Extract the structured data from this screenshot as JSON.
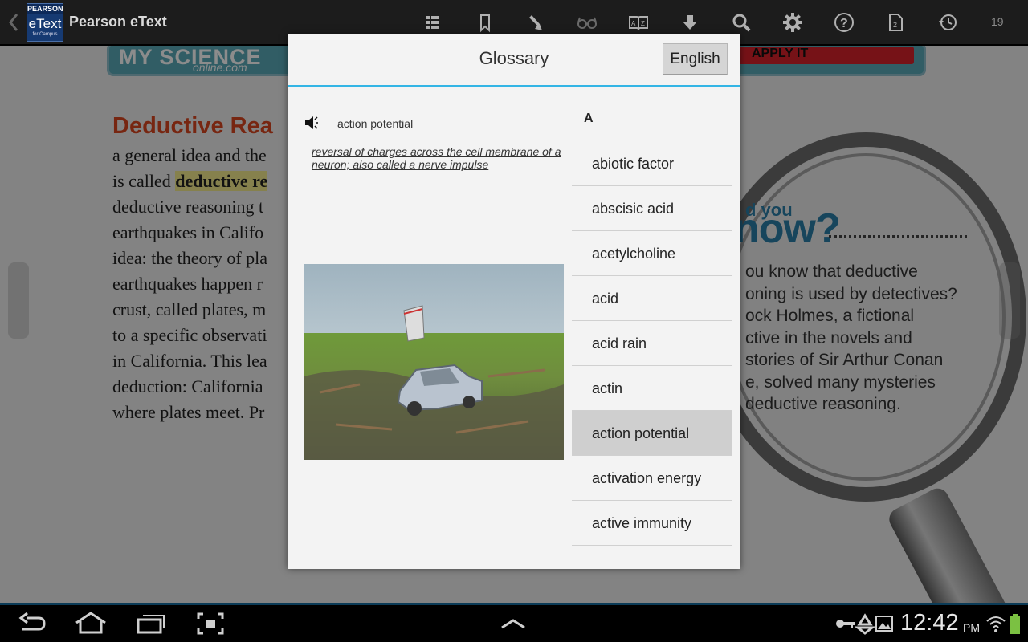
{
  "topbar": {
    "app_title": "Pearson eText",
    "logo": {
      "top": "PEARSON",
      "main": "eText",
      "sub": "for Campus"
    },
    "page_number": "19",
    "icons": [
      "back-icon",
      "table-of-contents-icon",
      "bookmark-icon",
      "highlighter-icon",
      "glasses-icon",
      "glossary-icon",
      "download-icon",
      "search-icon",
      "settings-icon",
      "help-icon",
      "page-icon",
      "history-icon"
    ]
  },
  "book": {
    "banner_left": "MY SCIENCE",
    "banner_sub": "online.com",
    "banner_right": "APPLY IT",
    "heading": "Deductive Rea",
    "lines": [
      "a general idea and the",
      "is called ",
      "deductive reasoning t",
      "earthquakes in Califo",
      "idea: the theory of pla",
      "earthquakes happen r",
      "crust, called plates, m",
      "to a specific observati",
      "in California. This lea",
      "deduction: California",
      "where plates meet. Pr"
    ],
    "highlight": "deductive re",
    "did_you_know": {
      "you": "d you",
      "know": "now?",
      "lines": [
        "ou know that deductive",
        "oning is used by detectives?",
        "ock Holmes, a fictional",
        "ctive in the novels and",
        "stories of Sir Arthur Conan",
        "e, solved many mysteries",
        "deductive reasoning."
      ]
    }
  },
  "glossary": {
    "title": "Glossary",
    "language_button": "English",
    "term": "action potential",
    "definition": "reversal of charges across the cell membrane of a neuron; also called a nerve impulse",
    "list_header": "A",
    "items": [
      "abiotic factor",
      "abscisic acid",
      "acetylcholine",
      "acid",
      "acid rain",
      "actin",
      "action potential",
      "activation energy",
      "active immunity"
    ],
    "selected_item": "action potential"
  },
  "systembar": {
    "time": "12:42",
    "ampm": "PM",
    "icons": [
      "back-nav-icon",
      "home-nav-icon",
      "recent-apps-icon",
      "screenshot-icon",
      "up-chevron-icon",
      "key-icon",
      "recycle-icon",
      "gallery-icon",
      "wifi-icon",
      "battery-icon"
    ]
  },
  "colors": {
    "accent": "#33b5e5",
    "heading_red": "#d9451f",
    "highlight_yellow": "#f4ec8c",
    "selected_row": "#cfcfcf"
  }
}
